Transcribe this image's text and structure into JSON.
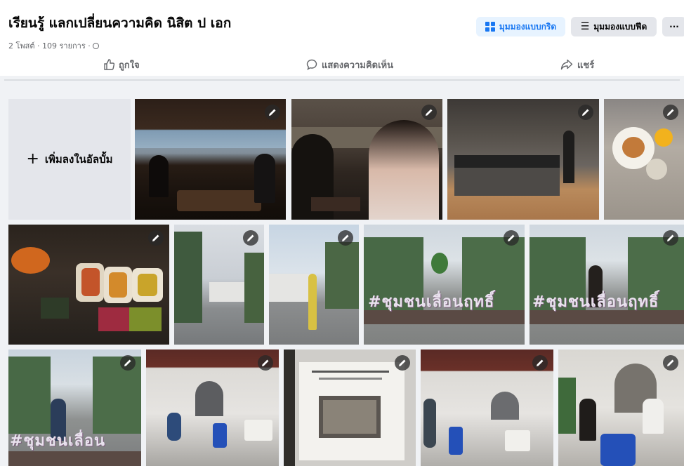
{
  "album": {
    "title": "เรียนรู้ แลกเปลี่ยนความคิด นิสิต ป เอก",
    "meta": "2 โพสต์ · 109 รายการ ·"
  },
  "view_buttons": {
    "grid_label": "มุมมองแบบกริด",
    "feed_label": "มุมมองแบบฟีด",
    "more_label": "···"
  },
  "actions": {
    "like_label": "ถูกใจ",
    "comment_label": "แสดงความคิดเห็น",
    "share_label": "แชร์"
  },
  "add_tile": {
    "label": "เพิ่มลงในอัลบั้ม"
  },
  "signs": {
    "sign1": "#ชุมชนเลื่อนฤทธิ์",
    "sign2": "#ชุมชนเลื่อนฤทธิ์",
    "sign3": "#ชุมชนเลื่อน"
  },
  "colors": {
    "accent": "#1877f2",
    "accent_bg": "#e7f3ff",
    "button_bg": "#e4e6eb",
    "page_bg": "#f0f2f5"
  }
}
